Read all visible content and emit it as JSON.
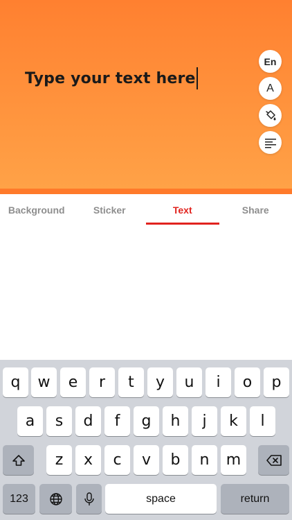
{
  "canvas": {
    "text": "Type your text here",
    "gradient_top": "#ff8030",
    "gradient_bottom": "#ffa247"
  },
  "side_tools": [
    {
      "name": "language",
      "label": "En",
      "icon": "language-icon"
    },
    {
      "name": "font",
      "label": "A",
      "icon": "font-icon"
    },
    {
      "name": "color",
      "label": "",
      "icon": "paint-bucket-icon"
    },
    {
      "name": "align",
      "label": "",
      "icon": "align-left-icon"
    }
  ],
  "tabs": [
    {
      "label": "Background",
      "active": false
    },
    {
      "label": "Sticker",
      "active": false
    },
    {
      "label": "Text",
      "active": true
    },
    {
      "label": "Share",
      "active": false
    }
  ],
  "accent_color": "#e1231e",
  "keyboard": {
    "row1": [
      "q",
      "w",
      "e",
      "r",
      "t",
      "y",
      "u",
      "i",
      "o",
      "p"
    ],
    "row2": [
      "a",
      "s",
      "d",
      "f",
      "g",
      "h",
      "j",
      "k",
      "l"
    ],
    "row3": [
      "z",
      "x",
      "c",
      "v",
      "b",
      "n",
      "m"
    ],
    "numbers_label": "123",
    "space_label": "space",
    "return_label": "return"
  }
}
